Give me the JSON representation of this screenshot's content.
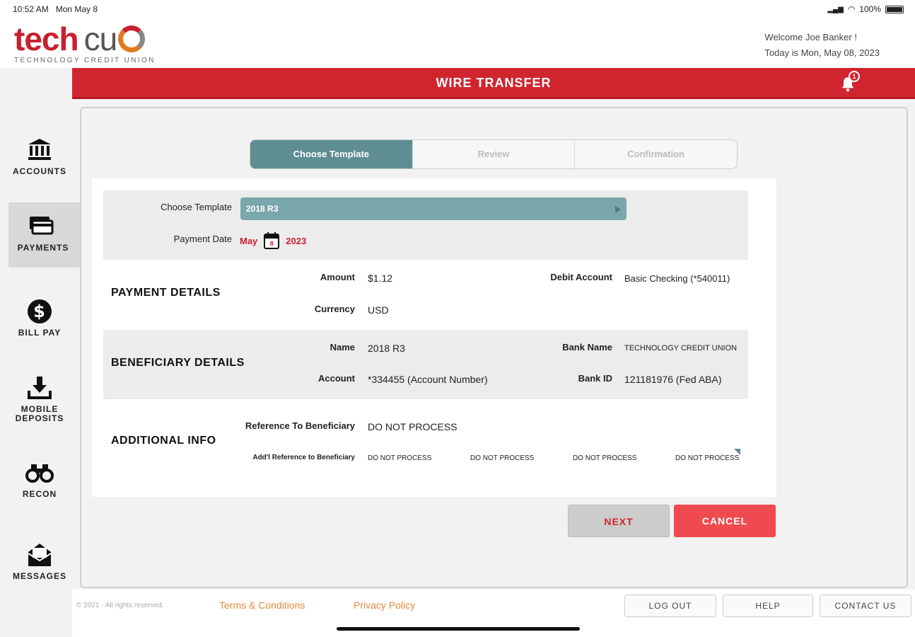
{
  "status": {
    "time": "10:52 AM",
    "date": "Mon May 8",
    "battery": "100%"
  },
  "brand": {
    "name_part1": "tech",
    "name_part2": "cu",
    "tagline": "TECHNOLOGY CREDIT UNION"
  },
  "header": {
    "welcome": "Welcome Joe Banker !",
    "today": "Today is Mon, May 08, 2023"
  },
  "page": {
    "title": "WIRE TRANSFER",
    "notification_count": "1"
  },
  "sidebar": {
    "items": [
      {
        "label": "ACCOUNTS",
        "icon": "bank-icon"
      },
      {
        "label": "PAYMENTS",
        "icon": "payments-icon"
      },
      {
        "label": "BILL PAY",
        "icon": "dollar-icon"
      },
      {
        "label_line1": "MOBILE",
        "label_line2": "DEPOSITS",
        "icon": "download-icon"
      },
      {
        "label": "RECON",
        "icon": "binoculars-icon"
      },
      {
        "label": "MESSAGES",
        "icon": "envelope-icon"
      }
    ]
  },
  "steps": [
    "Choose Template",
    "Review",
    "Confirmation"
  ],
  "template": {
    "choose_label": "Choose Template",
    "choose_value": "2018 R3",
    "date_label": "Payment Date",
    "date_month": "May",
    "date_day": "8",
    "date_year": "2023"
  },
  "payment_details": {
    "title": "PAYMENT DETAILS",
    "amount_label": "Amount",
    "amount_value": "$1.12",
    "currency_label": "Currency",
    "currency_value": "USD",
    "debit_label": "Debit Account",
    "debit_value": "Basic Checking (*540011)"
  },
  "beneficiary_details": {
    "title": "BENEFICIARY DETAILS",
    "name_label": "Name",
    "name_value": "2018 R3",
    "account_label": "Account",
    "account_value": "*334455 (Account Number)",
    "bank_name_label": "Bank Name",
    "bank_name_value": "TECHNOLOGY CREDIT UNION",
    "bank_id_label": "Bank ID",
    "bank_id_value": "121181976 (Fed ABA)"
  },
  "additional_info": {
    "title": "ADDITIONAL INFO",
    "ref_label": "Reference To Beneficiary",
    "ref_value": "DO NOT PROCESS",
    "addl_label": "Add'l Reference to Beneficiary",
    "addl_values": [
      "DO NOT PROCESS",
      "DO NOT PROCESS",
      "DO NOT PROCESS",
      "DO NOT PROCESS"
    ]
  },
  "actions": {
    "next": "NEXT",
    "cancel": "CANCEL"
  },
  "footer": {
    "copyright": "© 2021 - All rights reserved.",
    "terms": "Terms & Conditions",
    "privacy": "Privacy Policy",
    "logout": "LOG OUT",
    "help": "HELP",
    "contact": "CONTACT US"
  }
}
